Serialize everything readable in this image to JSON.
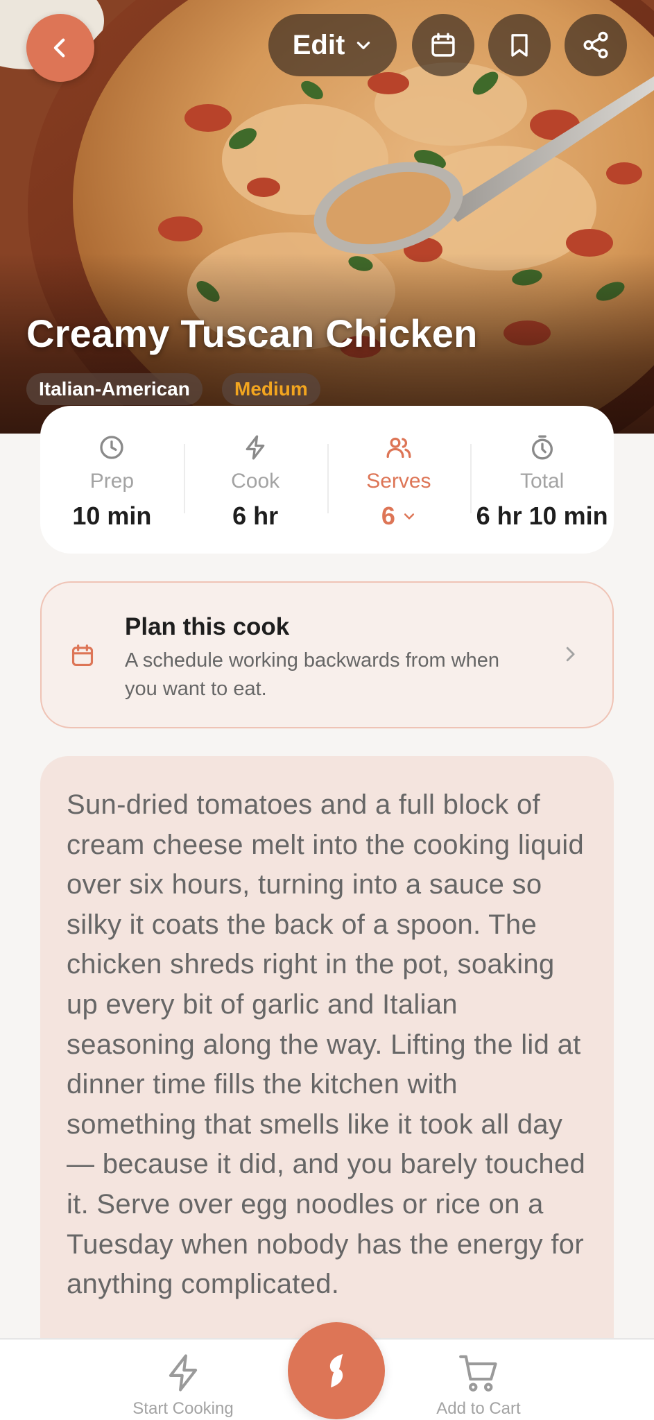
{
  "header": {
    "edit_label": "Edit",
    "back_icon": "chevron-left-icon",
    "calendar_icon": "calendar-icon",
    "bookmark_icon": "bookmark-icon",
    "share_icon": "share-icon"
  },
  "recipe": {
    "title": "Creamy Tuscan Chicken",
    "cuisine": "Italian-American",
    "difficulty": "Medium"
  },
  "stats": {
    "prep": {
      "label": "Prep",
      "value": "10 min",
      "icon": "clock-icon"
    },
    "cook": {
      "label": "Cook",
      "value": "6 hr",
      "icon": "bolt-icon"
    },
    "serves": {
      "label": "Serves",
      "value": "6",
      "icon": "users-icon"
    },
    "total": {
      "label": "Total",
      "value": "6 hr 10 min",
      "icon": "stopwatch-icon"
    }
  },
  "plan": {
    "title": "Plan this cook",
    "subtitle": "A schedule working backwards from when you want to eat."
  },
  "description": "Sun-dried tomatoes and a full block of cream cheese melt into the cooking liquid over six hours, turning into a sauce so silky it coats the back of a spoon. The chicken shreds right in the pot, soaking up every bit of garlic and Italian seasoning along the way. Lifting the lid at dinner time fills the kitchen with something that smells like it took all day — because it did, and you barely touched it. Serve over egg noodles or rice on a Tuesday when nobody has the energy for anything complicated.",
  "bottom_nav": {
    "start_label": "Start Cooking",
    "cart_label": "Add to Cart"
  },
  "colors": {
    "accent": "#dd7556",
    "difficulty": "#f2a51f",
    "muted": "#a3a3a3"
  }
}
